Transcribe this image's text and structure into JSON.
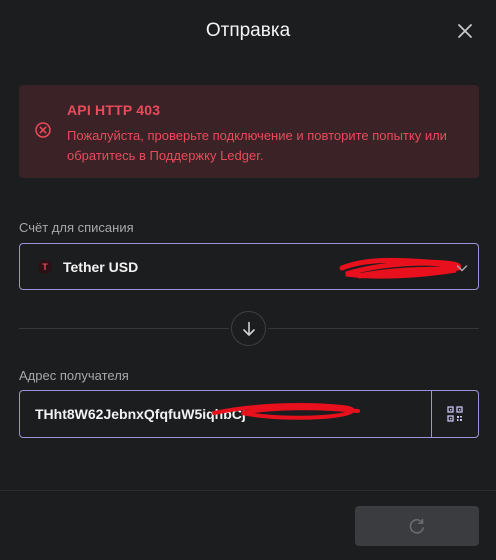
{
  "header": {
    "title": "Отправка",
    "close_icon": "close-icon"
  },
  "error": {
    "title": "API HTTP 403",
    "message": "Пожалуйста, проверьте подключение и повторите попытку или обратитесь в Поддержку Ledger.",
    "icon": "error-circle-icon",
    "color": "#ea4b5b",
    "background": "#3a2227"
  },
  "account": {
    "label": "Счёт для списания",
    "name": "Tether USD",
    "token_symbol": "T",
    "icon": "tether-icon",
    "chevron_icon": "chevron-down-icon"
  },
  "swap": {
    "icon": "arrow-down-icon"
  },
  "recipient": {
    "label": "Адрес получателя",
    "value": "THht8W62JebnxQfqfuW5iqhbCj",
    "qr_icon": "qr-code-icon"
  },
  "footer": {
    "continue_icon": "spinner-icon"
  },
  "colors": {
    "background": "#1c1d1f",
    "accent_border": "#9a93d9",
    "redaction": "#e8101c"
  }
}
